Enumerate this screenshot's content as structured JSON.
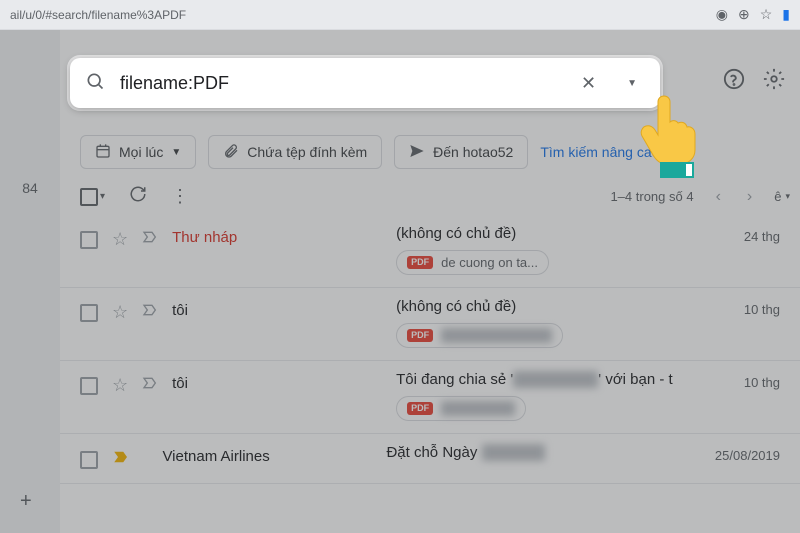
{
  "url_bar": {
    "path": "ail/u/0/#search/filename%3APDF"
  },
  "search": {
    "value": "filename:PDF",
    "clear_icon_label": "clear",
    "dropdown_icon_label": "options"
  },
  "top_right": {
    "help": "help-icon",
    "settings": "settings-icon"
  },
  "chips": {
    "time": {
      "icon": "calendar",
      "label": "Mọi lúc",
      "has_dropdown": true
    },
    "attachment": {
      "icon": "attachment",
      "label": "Chứa tệp đính kèm"
    },
    "to": {
      "icon": "send",
      "label": "Đến hotao52"
    },
    "advanced": "Tìm kiếm nâng cao"
  },
  "toolbar": {
    "pagination": "1–4 trong số 4",
    "lang": "ê"
  },
  "left_gutter": {
    "count": "84"
  },
  "emails": [
    {
      "sender": "Thư nháp",
      "sender_class": "draft",
      "star": false,
      "gold_star": false,
      "subject": "(không có chủ đề)",
      "attachment_label": "de cuong on ta...",
      "attachment_blur": false,
      "date": "24 thg"
    },
    {
      "sender": "tôi",
      "sender_class": "",
      "star": false,
      "gold_star": false,
      "subject": "(không có chủ đề)",
      "attachment_label": "████████████",
      "attachment_blur": true,
      "date": "10 thg"
    },
    {
      "sender": "tôi",
      "sender_class": "",
      "star": false,
      "gold_star": false,
      "subject_prefix": "Tôi đang chia sẻ '",
      "subject_blur": "████████",
      "subject_suffix": "' với bạn - t",
      "attachment_label": "████████",
      "attachment_blur": true,
      "date": "10 thg"
    },
    {
      "sender": "Vietnam Airlines",
      "sender_class": "",
      "star": true,
      "gold_star": true,
      "subject_prefix": "Đặt chỗ Ngày ",
      "subject_blur": "██████",
      "subject_suffix": "",
      "date": "25/08/2019"
    }
  ]
}
